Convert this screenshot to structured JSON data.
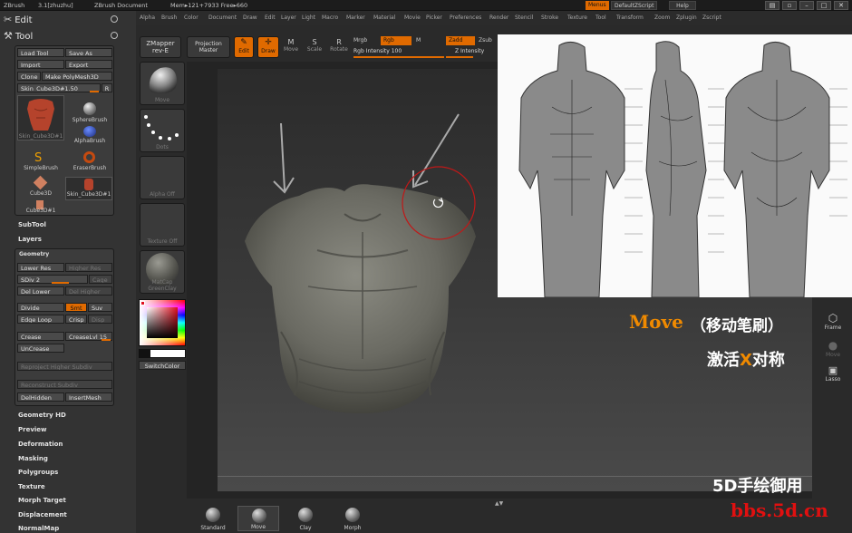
{
  "titlebar": {
    "app": "ZBrush",
    "version": "3.1[zhuzhu]",
    "document": "ZBrush Document",
    "mem": "Mem▸121+7933 Free▸660",
    "menus_label": "Menus",
    "script_label": "DefaultZScript",
    "help_label": "Help"
  },
  "menubar": [
    "Alpha",
    "Brush",
    "Color",
    "Document",
    "Draw",
    "Edit",
    "Layer",
    "Light",
    "Macro",
    "Marker",
    "Material",
    "Movie",
    "Picker",
    "Preferences",
    "Render",
    "Stencil",
    "Stroke",
    "Texture",
    "Tool",
    "Transform",
    "Zoom",
    "Zplugin",
    "Zscript"
  ],
  "left": {
    "edit_header": "Edit",
    "tool_header": "Tool",
    "tool_buttons": {
      "load": "Load Tool",
      "save_as": "Save As",
      "import": "Import",
      "export": "Export",
      "clone": "Clone",
      "make_polymesh": "Make PolyMesh3D"
    },
    "tool_slider": {
      "label": "Skin_Cube3D#1.50",
      "r": "R"
    },
    "tools": [
      {
        "label": "Skin_Cube3D#1"
      },
      {
        "label": "SphereBrush"
      },
      {
        "label": "AlphaBrush"
      },
      {
        "label": "SimpleBrush"
      },
      {
        "label": "EraserBrush"
      },
      {
        "label": "Cube3D"
      },
      {
        "label": "Skin_Cube3D#1"
      },
      {
        "label": "Cube3D#1"
      }
    ],
    "subtool": "SubTool",
    "layers": "Layers",
    "geometry": {
      "title": "Geometry",
      "lower_res": "Lower Res",
      "higher_res": "Higher Res",
      "sdiv": "SDiv 2",
      "cage": "Cage",
      "sdiv_level": 0.5,
      "del_lower": "Del Lower",
      "del_higher": "Del Higher",
      "divide": "Divide",
      "smt": "Smt",
      "suv": "Suv",
      "edge_loop": "Edge Loop",
      "crisp": "Crisp",
      "disp": "Disp",
      "crease": "Crease",
      "crease_lvl": "CreaseLvl 15",
      "uncrease": "UnCrease",
      "reproject": "Reproject Higher Subdiv",
      "reconstruct": "Reconstruct Subdiv",
      "del_hidden": "DelHidden",
      "insert_mesh": "InsertMesh"
    },
    "sections": [
      "Geometry HD",
      "Preview",
      "Deformation",
      "Masking",
      "Polygroups",
      "Texture",
      "Morph Target",
      "Displacement",
      "NormalMap"
    ]
  },
  "top_shelf": {
    "zmapper": [
      "ZMapper",
      "rev-E"
    ],
    "projection": [
      "Projection",
      "Master"
    ],
    "edit": "Edit",
    "draw": "Draw",
    "move": "Move",
    "scale": "Scale",
    "rotate": "Rotate",
    "mrgb": "Mrgb",
    "rgb": "Rgb",
    "m": "M",
    "rgb_intensity": "Rgb Intensity 100",
    "zadd": "Zadd",
    "zsub": "Zsub",
    "z_intensity": "Z Intensity"
  },
  "shelf": {
    "brush": "Move",
    "stroke": "Dots",
    "alpha": "Alpha Off",
    "texture": "Texture Off",
    "material": "MatCap GreenClay",
    "switch_color": "SwitchColor"
  },
  "right_tray": [
    "Frame",
    "Move",
    "Lasso"
  ],
  "bottom_brushes": [
    "Standard",
    "Move",
    "Clay",
    "Morph"
  ],
  "overlay": {
    "brush_name": "Move",
    "brush_desc": "（移动笔刷）",
    "symmetry_pre": "激活",
    "symmetry_x": "X",
    "symmetry_post": "对称",
    "watermark": "5D手绘御用",
    "site": "bbs.5d.cn"
  },
  "colors": {
    "accent": "#e06a00",
    "panel": "#333333",
    "overlay_orange": "#f08a00",
    "site_red": "#e01010"
  }
}
